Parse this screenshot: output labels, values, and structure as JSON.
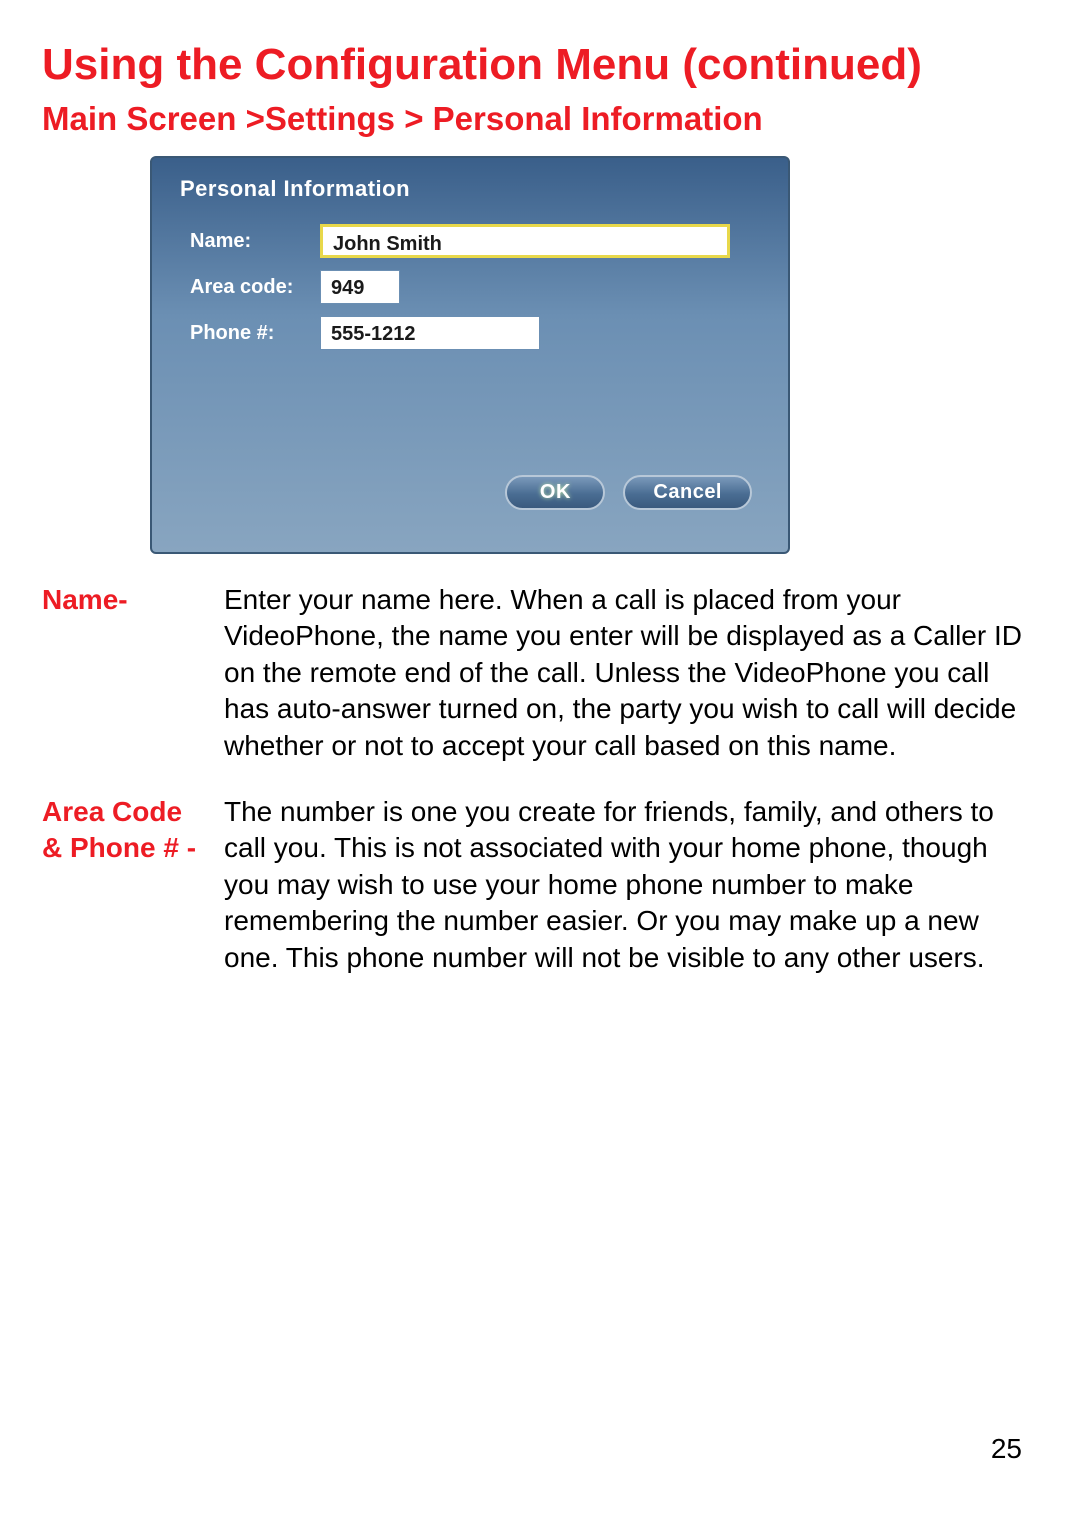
{
  "header": {
    "title": "Using the Configuration Menu (continued)",
    "breadcrumb": "Main Screen >Settings > Personal Information"
  },
  "panel": {
    "title": "Personal Information",
    "fields": {
      "name": {
        "label": "Name:",
        "value": "John Smith"
      },
      "area": {
        "label": "Area code:",
        "value": "949"
      },
      "phone": {
        "label": "Phone #:",
        "value": "555-1212"
      }
    },
    "buttons": {
      "ok": "OK",
      "cancel": "Cancel"
    }
  },
  "descriptions": {
    "name": {
      "term": "Name-",
      "text": "Enter your name here. When a call is placed from your VideoPhone, the name you enter will be displayed as a Caller ID on the remote end of the call. Unless the VideoPhone you call has auto-answer turned on, the party you wish to call will decide whether or not to accept your call based on this name."
    },
    "area_phone": {
      "term": "Area Code & Phone # -",
      "text": "The number is one you create for friends, family, and others to call you. This is not associated with your home phone, though you may wish to use your home phone number to make remembering the number easier. Or you may make up a new one. This phone number will not be visible to any other users."
    }
  },
  "page_number": "25"
}
